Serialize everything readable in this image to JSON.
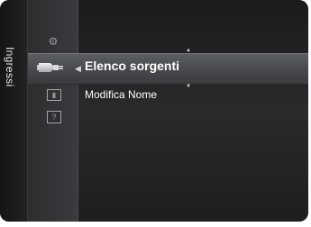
{
  "sidebar": {
    "label": "Ingressi"
  },
  "icons": {
    "settings": "gear-icon",
    "input": "input-plug-icon",
    "picture": "tv-small-icon",
    "help": "help-icon"
  },
  "menu": {
    "selected": "Elenco sorgenti",
    "items": [
      "Modifica Nome"
    ]
  },
  "colors": {
    "background": "#232326",
    "highlight": "#4f5054",
    "text": "#ffffff"
  }
}
